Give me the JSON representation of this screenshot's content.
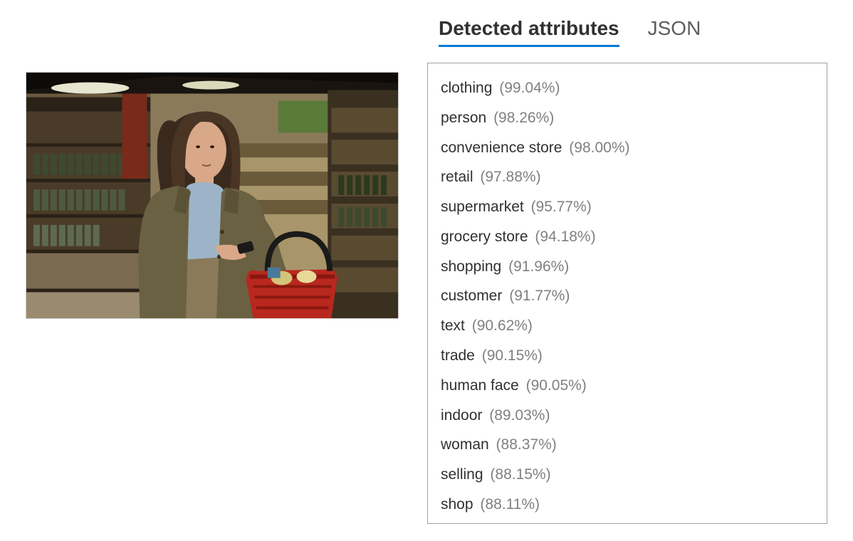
{
  "tabs": {
    "detected": "Detected attributes",
    "json": "JSON"
  },
  "image": {
    "description": "Woman with long brown hair wearing olive jacket over blue shirt, holding phone and red shopping basket in grocery store aisle"
  },
  "attributes": [
    {
      "label": "clothing",
      "confidence": "(99.04%)"
    },
    {
      "label": "person",
      "confidence": "(98.26%)"
    },
    {
      "label": "convenience store",
      "confidence": "(98.00%)"
    },
    {
      "label": "retail",
      "confidence": "(97.88%)"
    },
    {
      "label": "supermarket",
      "confidence": "(95.77%)"
    },
    {
      "label": "grocery store",
      "confidence": "(94.18%)"
    },
    {
      "label": "shopping",
      "confidence": "(91.96%)"
    },
    {
      "label": "customer",
      "confidence": "(91.77%)"
    },
    {
      "label": "text",
      "confidence": "(90.62%)"
    },
    {
      "label": "trade",
      "confidence": "(90.15%)"
    },
    {
      "label": "human face",
      "confidence": "(90.05%)"
    },
    {
      "label": "indoor",
      "confidence": "(89.03%)"
    },
    {
      "label": "woman",
      "confidence": "(88.37%)"
    },
    {
      "label": "selling",
      "confidence": "(88.15%)"
    },
    {
      "label": "shop",
      "confidence": "(88.11%)"
    }
  ]
}
